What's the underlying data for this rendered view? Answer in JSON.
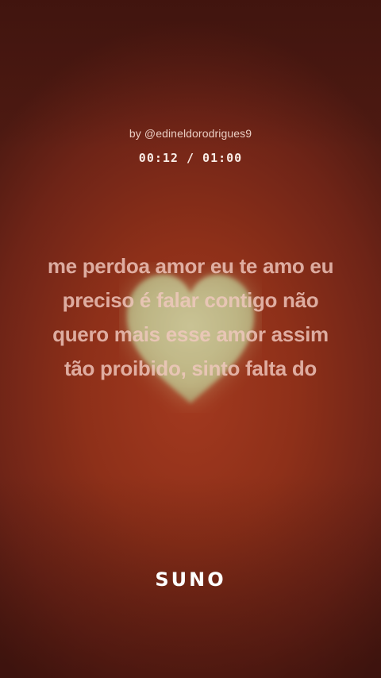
{
  "credit": "by @edineldorodrigues9",
  "player": {
    "current_time": "00:12",
    "separator": "/",
    "duration": "01:00",
    "progress_fraction": 0.2
  },
  "lyrics": {
    "lines": [
      "me perdoa amor eu te amo eu",
      "preciso é falar contigo não",
      "quero mais esse amor assim",
      "tão proibido, sinto falta do"
    ]
  },
  "artwork": {
    "icon": "heart-icon",
    "color": "#c9d7a2"
  },
  "brand": {
    "logo_text": "SUNO"
  },
  "colors": {
    "background_center": "#a3391f",
    "background_edge": "#4e1a12",
    "lyrics_text": "#f0c8be"
  }
}
